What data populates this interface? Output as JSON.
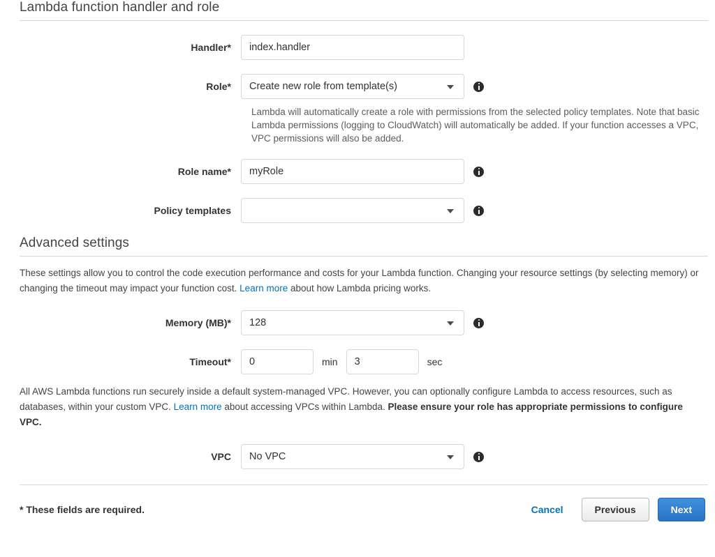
{
  "sections": {
    "handler_role": {
      "title": "Lambda function handler and role",
      "handler": {
        "label": "Handler*",
        "value": "index.handler"
      },
      "role": {
        "label": "Role*",
        "value": "Create new role from template(s)",
        "help": "Lambda will automatically create a role with permissions from the selected policy templates. Note that basic Lambda permissions (logging to CloudWatch) will automatically be added. If your function accesses a VPC, VPC permissions will also be added."
      },
      "role_name": {
        "label": "Role name*",
        "value": "myRole"
      },
      "policy_templates": {
        "label": "Policy templates",
        "value": ""
      }
    },
    "advanced": {
      "title": "Advanced settings",
      "description_before_link": "These settings allow you to control the code execution performance and costs for your Lambda function. Changing your resource settings (by selecting memory) or changing the timeout may impact your function cost. ",
      "description_link": "Learn more",
      "description_after_link": " about how Lambda pricing works.",
      "memory": {
        "label": "Memory (MB)*",
        "value": "128"
      },
      "timeout": {
        "label": "Timeout*",
        "minutes": "0",
        "minutes_unit": "min",
        "seconds": "3",
        "seconds_unit": "sec"
      },
      "vpc_description_before_link": "All AWS Lambda functions run securely inside a default system-managed VPC. However, you can optionally configure Lambda to access resources, such as databases, within your custom VPC. ",
      "vpc_description_link": "Learn more",
      "vpc_description_after_link": " about accessing VPCs within Lambda. ",
      "vpc_description_bold": "Please ensure your role has appropriate permissions to configure VPC.",
      "vpc": {
        "label": "VPC",
        "value": "No VPC"
      }
    }
  },
  "footer": {
    "required_note": "* These fields are required.",
    "cancel_label": "Cancel",
    "previous_label": "Previous",
    "next_label": "Next"
  },
  "colors": {
    "link": "#0073bb",
    "primary_button": "#2a72c5",
    "border": "#d8d8d8",
    "text": "#333333"
  }
}
